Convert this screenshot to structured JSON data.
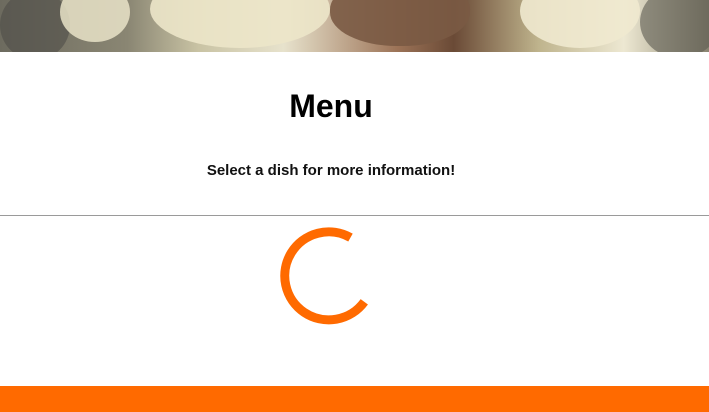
{
  "page": {
    "title": "Menu",
    "subtitle": "Select a dish for more information!"
  },
  "theme": {
    "accent": "#FF6A00",
    "divider": "#9A9A9A"
  },
  "loading": {
    "icon": "loading-spinner-icon"
  }
}
